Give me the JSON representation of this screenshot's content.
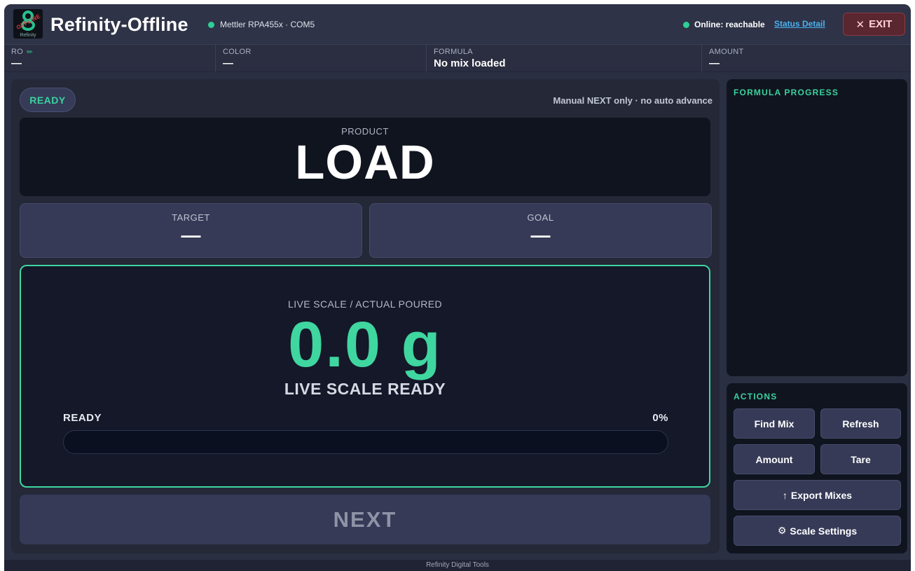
{
  "header": {
    "logo_text": "OFFLINE",
    "logo_word": "Refinity",
    "title": "Refinity-Offline",
    "device": "Mettler RPA455x · COM5",
    "online_status": "Online: reachable",
    "status_link": "Status Detail",
    "exit_icon": "✕",
    "exit_label": "EXIT"
  },
  "infobar": {
    "ro": {
      "label": "RO",
      "value": "—"
    },
    "color": {
      "label": "COLOR",
      "value": "—"
    },
    "formula": {
      "label": "FORMULA",
      "value": "No mix loaded"
    },
    "amount": {
      "label": "AMOUNT",
      "value": "—"
    }
  },
  "main": {
    "state_pill": "READY",
    "mode_note": "Manual NEXT only · no auto advance",
    "product_label": "PRODUCT",
    "product_value": "LOAD",
    "target_label": "TARGET",
    "target_value": "—",
    "goal_label": "GOAL",
    "goal_value": "—",
    "scale_label": "LIVE SCALE / ACTUAL POURED",
    "scale_value": "0.0 g",
    "scale_status": "LIVE SCALE READY",
    "progress_label": "READY",
    "progress_percent_text": "0%",
    "progress_fraction": 0,
    "next_label": "NEXT"
  },
  "formula_progress": {
    "title": "FORMULA PROGRESS"
  },
  "actions": {
    "title": "ACTIONS",
    "find_mix": "Find Mix",
    "refresh": "Refresh",
    "amount": "Amount",
    "tare": "Tare",
    "export_icon": "↑",
    "export": "Export Mixes",
    "settings_icon": "⚙",
    "settings": "Scale Settings"
  },
  "footer": {
    "text": "Refinity Digital Tools"
  },
  "colors": {
    "accent": "#3fd6a0",
    "status_dot": "#2fcf95",
    "link": "#4ab2f0",
    "exit_bg": "#5a2630"
  }
}
